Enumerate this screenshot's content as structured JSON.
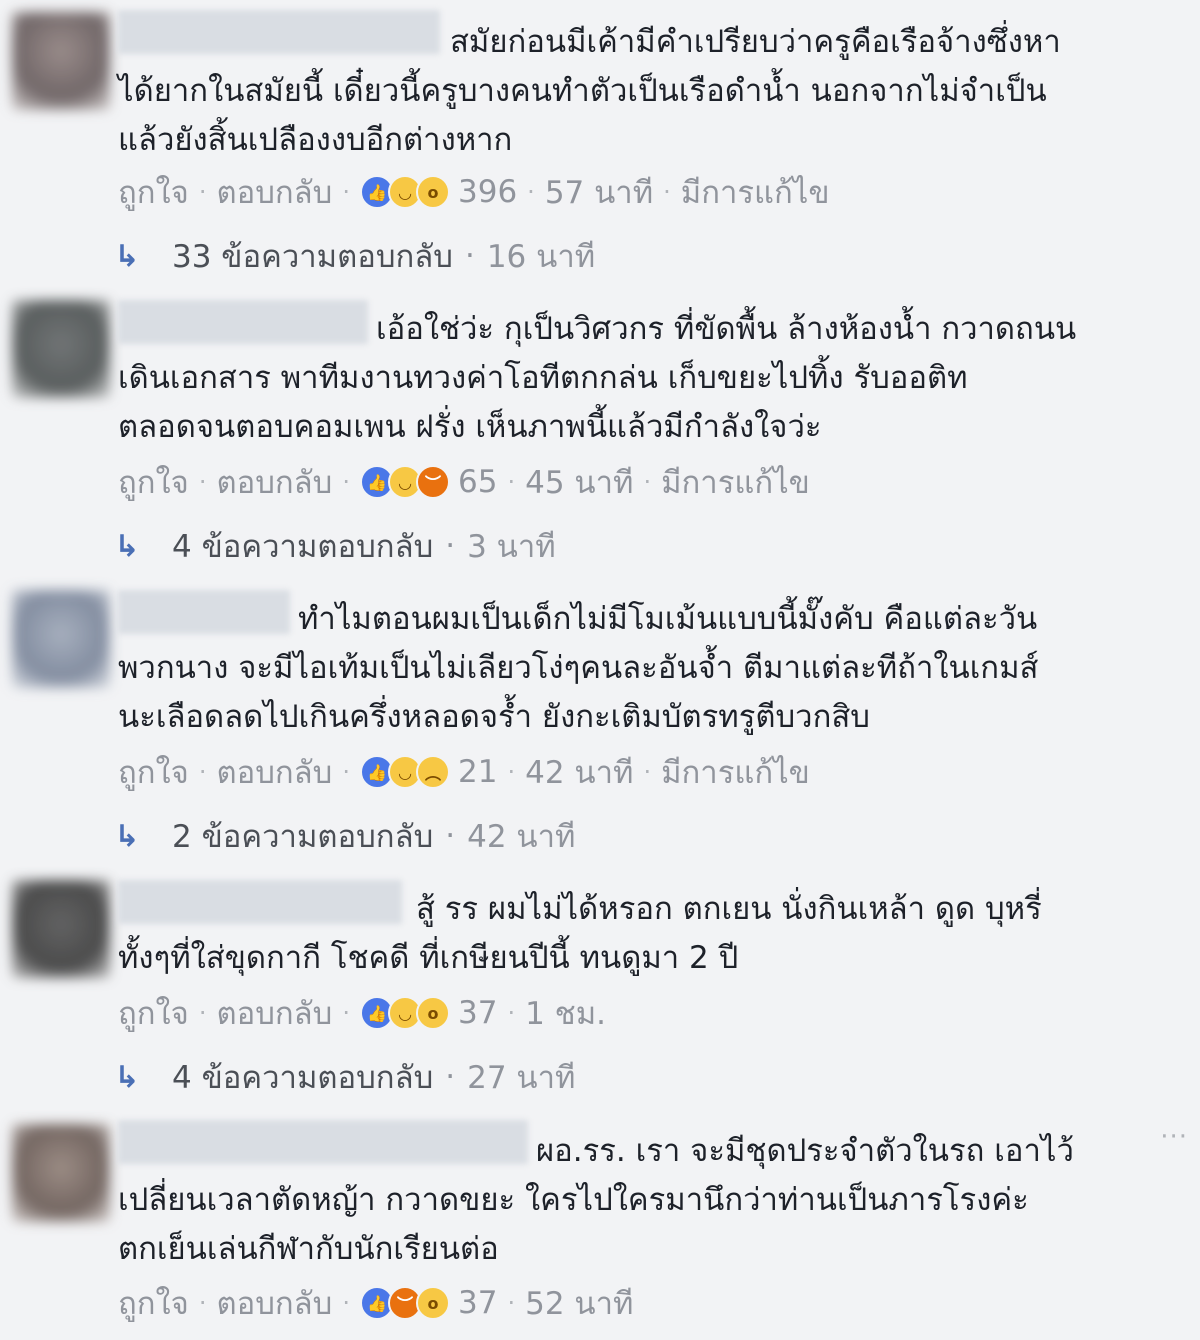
{
  "colors": {
    "page_bg": "#f2f3f5",
    "text": "#1d2129",
    "meta": "#90949c",
    "reply_arrow": "#4a6fb5",
    "like": "#4a77e8",
    "haha": "#f7c844",
    "angry": "#e9710f"
  },
  "actions": {
    "like": "ถูกใจ",
    "reply": "ตอบกลับ",
    "edited": "มีการแก้ไข",
    "separator": "·"
  },
  "comments": [
    {
      "lines": [
        "สมัยก่อนมีเค้ามีคำเปรียบว่าครูคือเรือจ้างซึ่งหา",
        "ได้ยากในสมัยนี้ เดี๋ยวนี้ครูบางคนทำตัวเป็นเรือดำน้ำ นอกจากไม่จำเป็น",
        "แล้วยังสิ้นเปลืองงบอีกต่างหาก"
      ],
      "reactions": [
        "like",
        "haha",
        "wow"
      ],
      "reaction_count": "396",
      "time": "57 นาที",
      "edited": true,
      "replies": "33 ข้อความตอบกลับ",
      "reply_time": "16 นาที"
    },
    {
      "lines": [
        "เอ้อใช่ว่ะ กุเป็นวิศวกร ที่ขัดพื้น ล้างห้องน้ำ กวาดถนน",
        "เดินเอกสาร พาทีมงานทวงค่าโอทีตกกล่น เก็บขยะไปทิ้ง รับออติท",
        "ตลอดจนตอบคอมเพน ฝรั่ง เห็นภาพนี้แล้วมีกำลังใจว่ะ"
      ],
      "reactions": [
        "like",
        "haha",
        "angry"
      ],
      "reaction_count": "65",
      "time": "45 นาที",
      "edited": true,
      "replies": "4 ข้อความตอบกลับ",
      "reply_time": "3 นาที"
    },
    {
      "lines": [
        "ทำไมตอนผมเป็นเด็กไม่มีโมเม้นแบบนี้มั๊งคับ คือแต่ละวัน",
        "พวกนาง จะมีไอเท้มเป็นไม่เลียวโง่ๆคนละอันจ้ำ ตีมาแต่ละทีถ้าในเกมส์",
        "นะเลือดลดไปเกินครึ่งหลอดจร้ำ ยังกะเติมบัตรทรูตีบวกสิบ"
      ],
      "reactions": [
        "like",
        "haha",
        "sad"
      ],
      "reaction_count": "21",
      "time": "42 นาที",
      "edited": true,
      "replies": "2 ข้อความตอบกลับ",
      "reply_time": "42 นาที"
    },
    {
      "lines": [
        "สู้ รร ผมไม่ได้หรอก ตกเยน นั่งกินเหล้า ดูด บุหรี่",
        "ทั้งๆที่ใส่ขุดกากี โชคดี ที่เกษียนปีนี้ ทนดูมา 2 ปี"
      ],
      "reactions": [
        "like",
        "haha",
        "wow"
      ],
      "reaction_count": "37",
      "time": "1 ชม.",
      "edited": false,
      "replies": "4 ข้อความตอบกลับ",
      "reply_time": "27 นาที"
    },
    {
      "lines": [
        "ผอ.รร. เรา จะมีชุดประจำตัวในรถ เอาไว้",
        "เปลี่ยนเวลาตัดหญ้า กวาดขยะ ใครไปใครมานึกว่าท่านเป็นภารโรงค่ะ",
        "ตกเย็นเล่นกีฬากับนักเรียนต่อ"
      ],
      "reactions": [
        "like",
        "angry",
        "wow"
      ],
      "reaction_count": "37",
      "time": "52 นาที",
      "edited": false,
      "replies": "",
      "reply_time": ""
    }
  ],
  "icons": {
    "reply_arrow": "reply-arrow-icon",
    "more": "more-options-icon",
    "like": "like-reaction-icon",
    "haha": "haha-reaction-icon",
    "wow": "wow-reaction-icon",
    "sad": "sad-reaction-icon",
    "angry": "angry-reaction-icon"
  },
  "more_glyph": "···"
}
